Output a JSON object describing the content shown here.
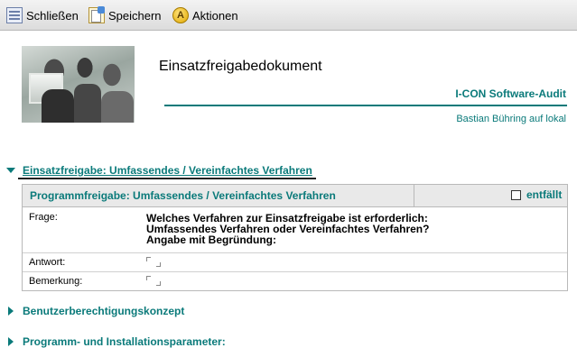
{
  "toolbar": {
    "close_label": "Schließen",
    "save_label": "Speichern",
    "actions_label": "Aktionen",
    "actions_icon_letter": "A"
  },
  "header": {
    "title": "Einsatzfreigabedokument",
    "company": "I-CON Software-Audit",
    "author": "Bastian Bühring auf lokal"
  },
  "sections": [
    {
      "title": "Einsatzfreigabe: Umfassendes / Vereinfachtes Verfahren",
      "expanded": true,
      "table": {
        "title": "Programmfreigabe: Umfassendes / Vereinfachtes Verfahren",
        "checkbox_label": "entfällt",
        "checkbox_checked": false,
        "rows": [
          {
            "label": "Frage:",
            "lines": [
              "Welches Verfahren zur Einsatzfreigabe ist erforderlich:",
              "Umfassendes Verfahren oder Vereinfachtes Verfahren?",
              "Angabe mit Begründung:"
            ]
          },
          {
            "label": "Antwort:",
            "value": ""
          },
          {
            "label": "Bemerkung:",
            "value": ""
          }
        ]
      }
    },
    {
      "title": "Benutzerberechtigungskonzept",
      "expanded": false
    },
    {
      "title": "Programm- und Installationsparameter:",
      "expanded": false
    }
  ],
  "colors": {
    "accent": "#0a7a7a",
    "toolbar_bg": "#e6e6e6",
    "table_header_bg": "#e9e9e9"
  },
  "icons": {
    "close": "close-document-icon",
    "save": "save-icon",
    "actions": "actions-icon"
  }
}
